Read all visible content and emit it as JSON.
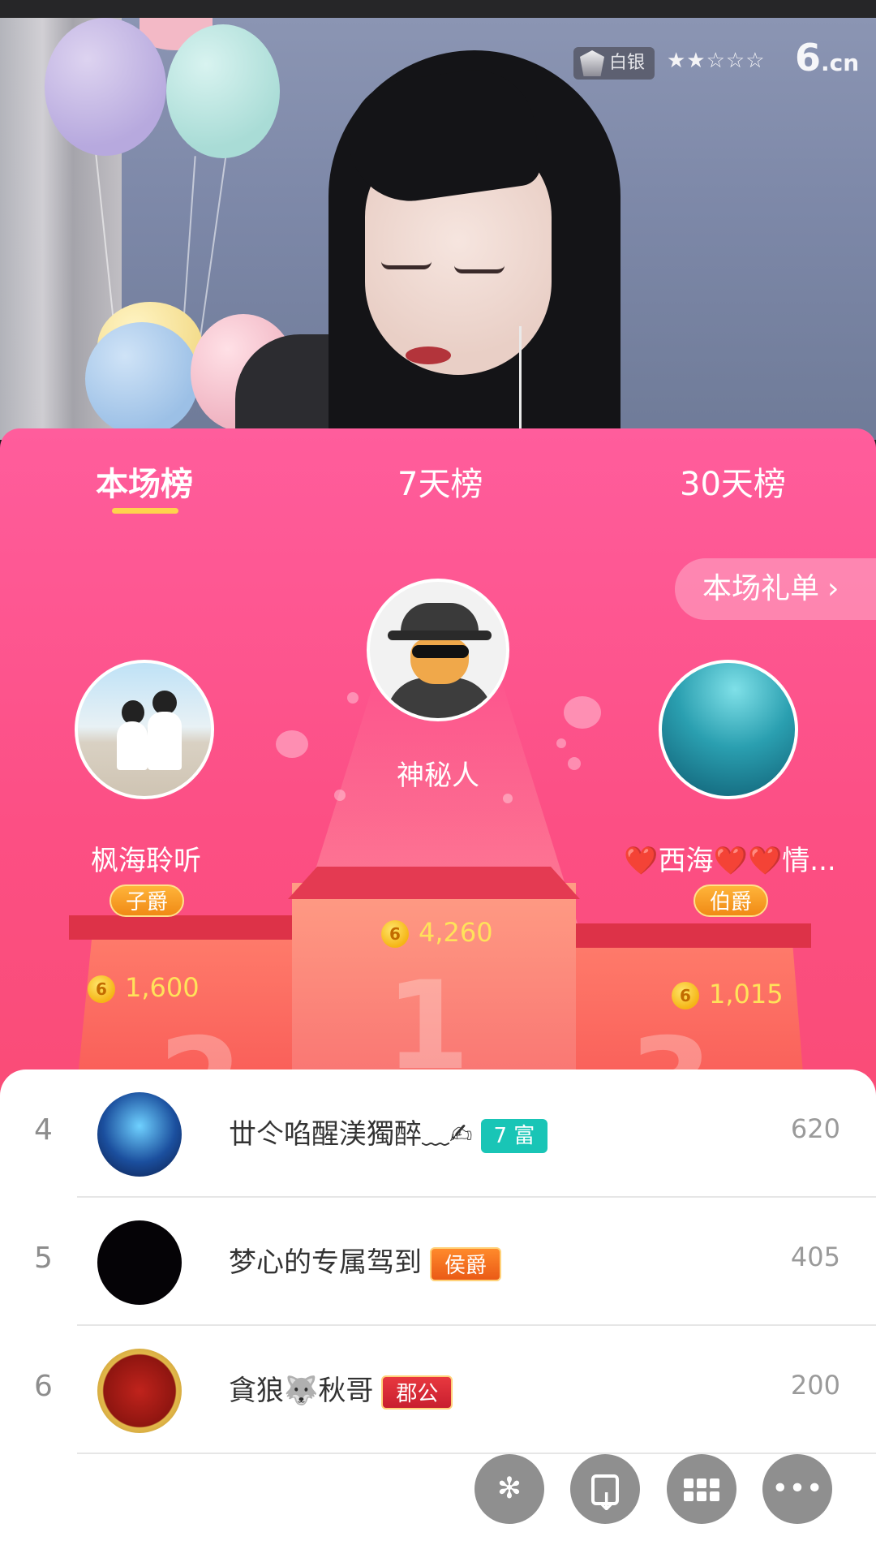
{
  "header": {
    "level_badge": "白银",
    "star_display": "★★☆☆☆",
    "brand": "6",
    "brand_suffix": ".cn"
  },
  "tabs": [
    {
      "label": "本场榜",
      "active": true
    },
    {
      "label": "7天榜",
      "active": false
    },
    {
      "label": "30天榜",
      "active": false
    }
  ],
  "gift_list_button": {
    "label": "本场礼单",
    "chevron": "›"
  },
  "podium": {
    "first": {
      "rank": 1,
      "name": "神秘人",
      "score": "4,260",
      "avatar": "spy-avatar"
    },
    "second": {
      "rank": 2,
      "name": "枫海聆听",
      "title": "子爵",
      "score": "1,600",
      "avatar": "couple-beach-avatar"
    },
    "third": {
      "rank": 3,
      "name": "❤️西海❤️❤️情...",
      "title": "伯爵",
      "score": "1,015",
      "avatar": "ocean-avatar"
    },
    "numbers": [
      "1",
      "2",
      "3"
    ]
  },
  "coin_glyph": "6",
  "list": [
    {
      "rank": "4",
      "name": "丗仒啗醒渼獨醉﹏✍",
      "badge": "7 富",
      "score": "620",
      "avatar": "skull-avatar"
    },
    {
      "rank": "5",
      "name": "梦心的专属驾到",
      "badge": "侯爵",
      "score": "405",
      "avatar": "black-avatar"
    },
    {
      "rank": "6",
      "name": "貪狼🐺秋哥",
      "badge": "郡公",
      "score": "200",
      "avatar": "emblem-avatar"
    }
  ],
  "bottom_actions": [
    {
      "name": "flower",
      "glyph": "✻"
    },
    {
      "name": "download"
    },
    {
      "name": "apps-grid"
    },
    {
      "name": "more",
      "glyph": "•••"
    }
  ],
  "colors": {
    "panel_top": "#ff5d9c",
    "panel_bottom": "#f54760",
    "score_gold": "#ffe25a",
    "tab_underline": "#ffd34d"
  }
}
